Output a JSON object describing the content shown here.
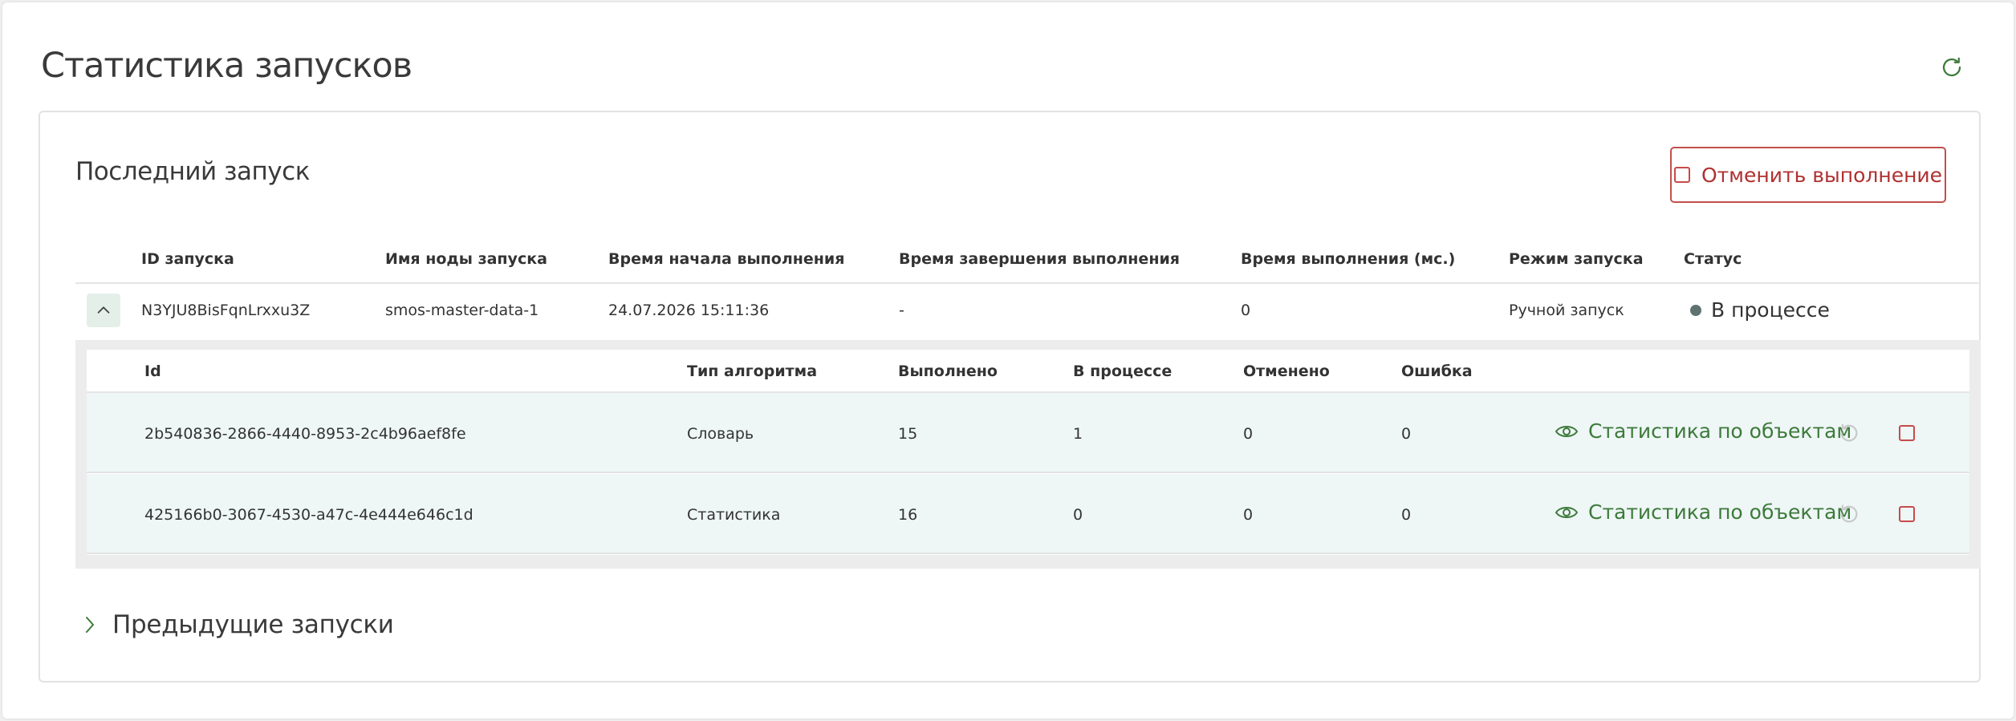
{
  "page": {
    "title": "Статистика запусков"
  },
  "colors": {
    "accent_green": "#3d7a3a",
    "danger_red": "#b03030",
    "status_dot": "#5f7272",
    "row_bg": "#eef6f6"
  },
  "icons": {
    "refresh": "refresh-icon",
    "cancel": "stop-square-icon",
    "toggle": "chevron-up-icon",
    "eye": "eye-icon",
    "retry": "retry-icon",
    "expand": "chevron-right-icon"
  },
  "last_run": {
    "title": "Последний запуск",
    "cancel_label": "Отменить выполнение",
    "columns": [
      "ID запуска",
      "Имя ноды запуска",
      "Время начала выполнения",
      "Время завершения выполнения",
      "Время выполнения (мс.)",
      "Режим запуска",
      "Статус"
    ],
    "row": {
      "id": "N3YJU8BisFqnLrxxu3Z",
      "node": "smos-master-data-1",
      "start": "24.07.2026 15:11:36",
      "end": "-",
      "duration": "0",
      "mode": "Ручной запуск",
      "status": "В процессе"
    },
    "sub_columns": [
      "Id",
      "Тип алгоритма",
      "Выполнено",
      "В процессе",
      "Отменено",
      "Ошибка"
    ],
    "sub_rows": [
      {
        "id": "2b540836-2866-4440-8953-2c4b96aef8fe",
        "type": "Словарь",
        "done": "15",
        "in_progress": "1",
        "cancelled": "0",
        "error": "0",
        "link": "Статистика по объектам"
      },
      {
        "id": "425166b0-3067-4530-a47c-4e444e646c1d",
        "type": "Статистика",
        "done": "16",
        "in_progress": "0",
        "cancelled": "0",
        "error": "0",
        "link": "Статистика по объектам"
      }
    ]
  },
  "previous_runs": {
    "title": "Предыдущие запуски"
  }
}
